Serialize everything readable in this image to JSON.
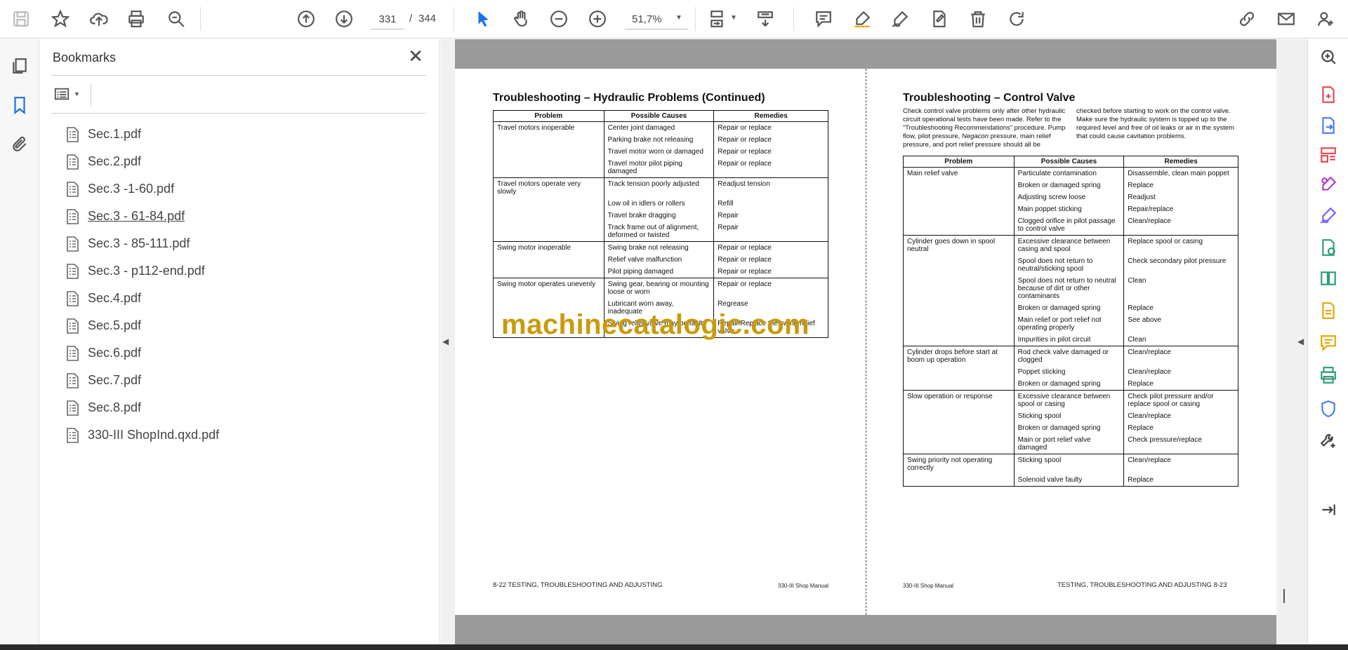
{
  "toolbar": {
    "page_current": "331",
    "page_separator": "/",
    "page_total": "344",
    "zoom": "51,7%",
    "tools": [
      "save-icon",
      "bookmark-star-icon",
      "upload-icon",
      "print-icon",
      "zoom-search-icon",
      "prev-page-icon",
      "next-page-icon",
      "select-cursor-icon",
      "hand-icon",
      "zoom-out-icon",
      "zoom-in-icon",
      "fit-page-icon",
      "scroll-mode-icon",
      "comment-icon",
      "highlight-icon",
      "sign-icon",
      "edit-text-icon",
      "delete-icon",
      "rotate-icon",
      "share-link-icon",
      "email-icon",
      "account-icon"
    ],
    "accent_color": "#1473e6"
  },
  "left_rail": [
    "pages-icon",
    "bookmarks-icon",
    "attachments-icon"
  ],
  "bookmarks": {
    "title": "Bookmarks",
    "items": [
      {
        "label": "Sec.1.pdf"
      },
      {
        "label": "Sec.2.pdf"
      },
      {
        "label": "Sec.3 -1-60.pdf"
      },
      {
        "label": "Sec.3 - 61-84.pdf"
      },
      {
        "label": "Sec.3 - 85-111.pdf"
      },
      {
        "label": "Sec.3 - p112-end.pdf"
      },
      {
        "label": "Sec.4.pdf"
      },
      {
        "label": "Sec.5.pdf"
      },
      {
        "label": "Sec.6.pdf"
      },
      {
        "label": "Sec.7.pdf"
      },
      {
        "label": "Sec.8.pdf"
      },
      {
        "label": "330-III ShopInd.qxd.pdf"
      }
    ],
    "active_index": 3
  },
  "left_page": {
    "title": "Troubleshooting – Hydraulic Problems (Continued)",
    "headers": [
      "Problem",
      "Possible Causes",
      "Remedies"
    ],
    "groups": [
      {
        "problem": "Travel motors inoperable",
        "rows": [
          [
            "Center joint damaged",
            "Repair or replace"
          ],
          [
            "Parking brake not releasing",
            "Repair or replace"
          ],
          [
            "Travel motor worn or damaged",
            "Repair or replace"
          ],
          [
            "Travel motor pilot piping damaged",
            "Repair or replace"
          ]
        ]
      },
      {
        "problem": "Travel motors operate very slowly",
        "rows": [
          [
            "Track tension poorly adjusted",
            "Readjust tension"
          ],
          [
            "Low oil in idlers or rollers",
            "Refill"
          ],
          [
            "Travel brake dragging",
            "Repair"
          ],
          [
            "Track frame out of alignment, deformed or twisted",
            "Repair"
          ]
        ]
      },
      {
        "problem": "Swing motor inoperable",
        "rows": [
          [
            "Swing brake not releasing",
            "Repair or replace"
          ],
          [
            "Relief valve malfunction",
            "Repair or replace"
          ],
          [
            "Pilot piping damaged",
            "Repair or replace"
          ]
        ]
      },
      {
        "problem": "Swing motor operates unevenly",
        "rows": [
          [
            "Swing gear, bearing or mounting loose or worn",
            "Repair or replace"
          ],
          [
            "Lubricant worn away, inadequate",
            "Regrease"
          ],
          [
            "Swing relief valve may be faulty",
            "Repair/Replace the swing relief valve"
          ]
        ]
      }
    ],
    "watermark": "machinecatalogic.com",
    "footer_left": "8-22    TESTING, TROUBLESHOOTING AND ADJUSTING",
    "footer_right": "330-III Shop Manual"
  },
  "right_page": {
    "title": "Troubleshooting – Control Valve",
    "intro_a": "Check control valve problems only after other hydraulic circuit operational tests have been made. Refer to the “Troubleshooting Recommendations” procedure. Pump flow, pilot pressure, ",
    "intro_italic": "Negacon",
    "intro_b": " pressure, main relief pressure, and port relief pressure should all be checked before starting to work on the control valve. Make sure the hydraulic system is topped up to the required level and free of oil leaks or air in the system that could cause cavitation problems.",
    "headers": [
      "Problem",
      "Possible Causes",
      "Remedies"
    ],
    "groups": [
      {
        "problem": "Main relief valve",
        "rows": [
          [
            "Particulate contamination",
            "Disassemble, clean main poppet"
          ],
          [
            "Broken or damaged spring",
            "Replace"
          ],
          [
            "Adjusting screw loose",
            "Readjust"
          ],
          [
            "Main poppet sticking",
            "Repair/replace"
          ],
          [
            "Clogged orifice in pilot passage to control valve",
            "Clean/replace"
          ]
        ]
      },
      {
        "problem": "Cylinder goes down in spool neutral",
        "rows": [
          [
            "Excessive clearance between casing and spool",
            "Replace spool or casing"
          ],
          [
            "Spool does not return to neutral/sticking spool",
            "Check secondary pilot pressure"
          ],
          [
            "Spool does not return to neutral because of dirt or other contaminants",
            "Clean"
          ],
          [
            "Broken or damaged spring",
            "Replace"
          ],
          [
            "Main relief or port relief not operating properly",
            "See above"
          ],
          [
            "Impurities in pilot circuit",
            "Clean"
          ]
        ]
      },
      {
        "problem": "Cylinder drops before start at boom up operation",
        "rows": [
          [
            "Rod check valve damaged or clogged",
            "Clean/replace"
          ],
          [
            "Poppet sticking",
            "Clean/replace"
          ],
          [
            "Broken or damaged spring",
            "Replace"
          ]
        ]
      },
      {
        "problem": "Slow operation or response",
        "rows": [
          [
            "Excessive clearance between spool or casing",
            "Check pilot pressure and/or replace spool or casing"
          ],
          [
            "Sticking spool",
            "Clean/replace"
          ],
          [
            "Broken or damaged spring",
            "Replace"
          ],
          [
            "Main or port relief valve damaged",
            "Check pressure/replace"
          ]
        ]
      },
      {
        "problem": "Swing priority not operating correctly",
        "rows": [
          [
            "Sticking spool",
            "Clean/replace"
          ],
          [
            "Solenoid valve faulty",
            "Replace"
          ]
        ]
      }
    ],
    "footer_left": "330-III Shop Manual",
    "footer_right": "TESTING, TROUBLESHOOTING AND ADJUSTING    8-23"
  },
  "right_rail": [
    {
      "name": "enhance-zoom-icon",
      "color": "#444"
    },
    {
      "name": "create-pdf-icon",
      "color": "#e34850"
    },
    {
      "name": "export-pdf-icon",
      "color": "#4b7bec"
    },
    {
      "name": "organize-pages-icon",
      "color": "#e34850"
    },
    {
      "name": "fill-sign-icon",
      "color": "#b03ad1"
    },
    {
      "name": "request-signature-icon",
      "color": "#7a5cff"
    },
    {
      "name": "send-track-icon",
      "color": "#2d9d78"
    },
    {
      "name": "compare-files-icon",
      "color": "#2d9d78"
    },
    {
      "name": "scan-ocr-icon",
      "color": "#e0a800"
    },
    {
      "name": "comment-tool-icon",
      "color": "#e0a800"
    },
    {
      "name": "print-production-icon",
      "color": "#2d9d78"
    },
    {
      "name": "protect-icon",
      "color": "#4b7bec"
    },
    {
      "name": "more-tools-icon",
      "color": "#444"
    },
    {
      "name": "collapse-rail-icon",
      "color": "#444"
    }
  ]
}
